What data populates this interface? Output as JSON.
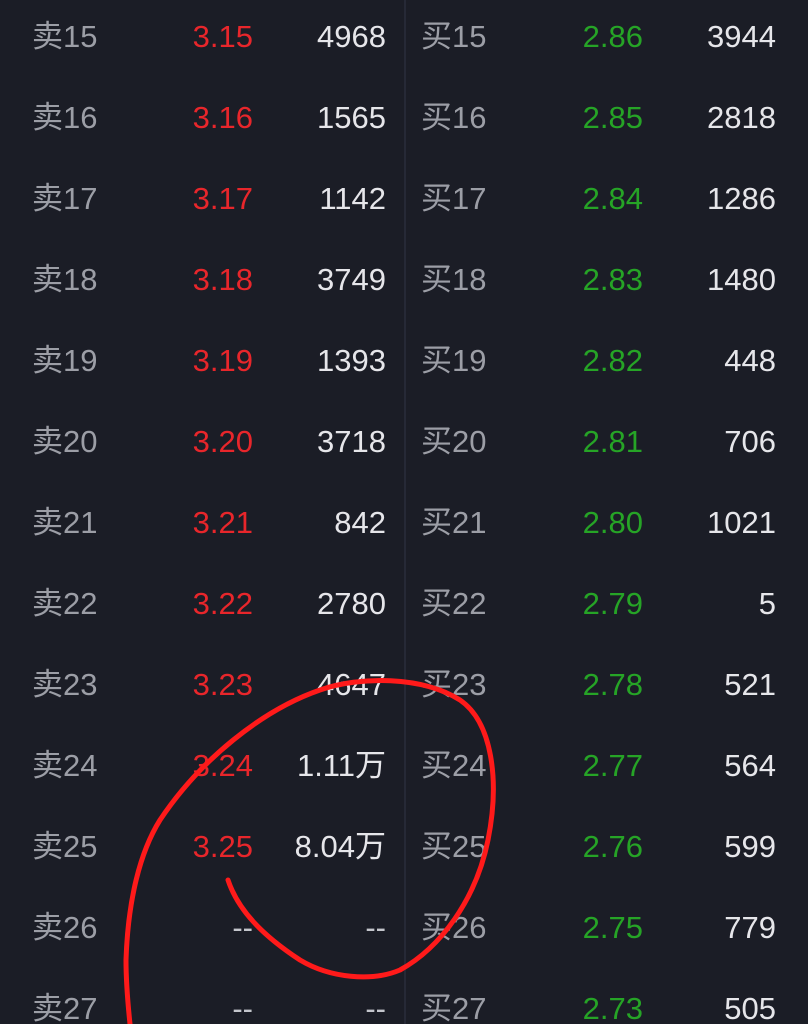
{
  "ask_rows": [
    {
      "label": "卖15",
      "price": "3.15",
      "volume": "4968"
    },
    {
      "label": "卖16",
      "price": "3.16",
      "volume": "1565"
    },
    {
      "label": "卖17",
      "price": "3.17",
      "volume": "1142"
    },
    {
      "label": "卖18",
      "price": "3.18",
      "volume": "3749"
    },
    {
      "label": "卖19",
      "price": "3.19",
      "volume": "1393"
    },
    {
      "label": "卖20",
      "price": "3.20",
      "volume": "3718"
    },
    {
      "label": "卖21",
      "price": "3.21",
      "volume": "842"
    },
    {
      "label": "卖22",
      "price": "3.22",
      "volume": "2780"
    },
    {
      "label": "卖23",
      "price": "3.23",
      "volume": "4647"
    },
    {
      "label": "卖24",
      "price": "3.24",
      "volume": "1.11万"
    },
    {
      "label": "卖25",
      "price": "3.25",
      "volume": "8.04万"
    },
    {
      "label": "卖26",
      "price": "--",
      "volume": "--"
    },
    {
      "label": "卖27",
      "price": "--",
      "volume": "--"
    }
  ],
  "bid_rows": [
    {
      "label": "买15",
      "price": "2.86",
      "volume": "3944"
    },
    {
      "label": "买16",
      "price": "2.85",
      "volume": "2818"
    },
    {
      "label": "买17",
      "price": "2.84",
      "volume": "1286"
    },
    {
      "label": "买18",
      "price": "2.83",
      "volume": "1480"
    },
    {
      "label": "买19",
      "price": "2.82",
      "volume": "448"
    },
    {
      "label": "买20",
      "price": "2.81",
      "volume": "706"
    },
    {
      "label": "买21",
      "price": "2.80",
      "volume": "1021"
    },
    {
      "label": "买22",
      "price": "2.79",
      "volume": "5"
    },
    {
      "label": "买23",
      "price": "2.78",
      "volume": "521"
    },
    {
      "label": "买24",
      "price": "2.77",
      "volume": "564"
    },
    {
      "label": "买25",
      "price": "2.76",
      "volume": "599"
    },
    {
      "label": "买26",
      "price": "2.75",
      "volume": "779"
    },
    {
      "label": "买27",
      "price": "2.73",
      "volume": "505"
    }
  ],
  "colors": {
    "background": "#1b1d26",
    "ask_price": "#e8262b",
    "bid_price": "#26a426",
    "volume": "#e6e6ea",
    "label": "#9c9ea6",
    "annotation": "#ff1a1a"
  }
}
